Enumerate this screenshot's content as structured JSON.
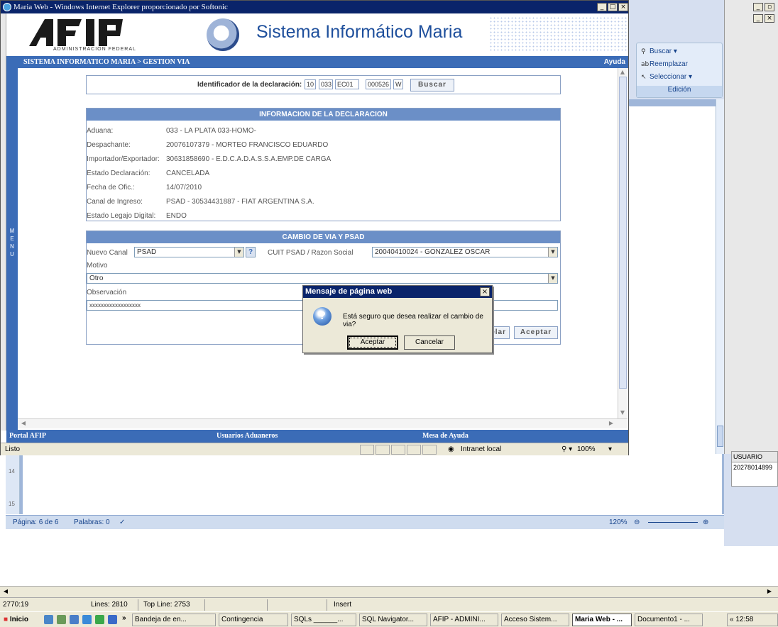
{
  "ie": {
    "title": "Maria Web - Windows Internet Explorer proporcionado por Softonic",
    "system_title": "Sistema Informático Maria",
    "logo_subtitle": "ADMINISTRACION FEDERAL",
    "breadcrumb": "SISTEMA INFORMATICO MARIA > GESTION VIA",
    "help": "Ayuda",
    "menu_letters": [
      "M",
      "E",
      "N",
      "U"
    ],
    "footer": {
      "portal": "Portal AFIP",
      "usuarios": "Usuarios Aduaneros",
      "mesa": "Mesa de Ayuda"
    },
    "status": {
      "ready": "Listo",
      "zone": "Intranet local",
      "zoom": "100%"
    }
  },
  "search": {
    "label": "Identificador de la declaración:",
    "fields": [
      "10",
      "033",
      "EC01",
      "000526",
      "W"
    ],
    "button": "Buscar"
  },
  "info": {
    "heading": "INFORMACION DE LA DECLARACION",
    "rows": [
      {
        "label": "Aduana:",
        "value": "033 - LA PLATA 033-HOMO-"
      },
      {
        "label": "Despachante:",
        "value": "20076107379 - MORTEO FRANCISCO EDUARDO"
      },
      {
        "label": "Importador/Exportador:",
        "value": "30631858690 - E.D.C.A.D.A.S.S.A.EMP.DE CARGA"
      },
      {
        "label": "Estado Declaración:",
        "value": "CANCELADA"
      },
      {
        "label": "Fecha de Ofic.:",
        "value": "14/07/2010"
      },
      {
        "label": "Canal de Ingreso:",
        "value": "PSAD - 30534431887 - FIAT ARGENTINA S.A."
      },
      {
        "label": "Estado Legajo Digital:",
        "value": "ENDO"
      }
    ]
  },
  "cambio": {
    "heading": "CAMBIO DE VIA Y PSAD",
    "nuevo_canal_label": "Nuevo Canal",
    "nuevo_canal_value": "PSAD",
    "help_q": "?",
    "cuit_label": "CUIT PSAD / Razon Social",
    "cuit_value": "20040410024 - GONZALEZ OSCAR",
    "motivo_label": "Motivo",
    "motivo_value": "Otro",
    "obs_label": "Observación",
    "obs_value": "xxxxxxxxxxxxxxxxxx",
    "cancel_partial": "elar",
    "accept": "Aceptar"
  },
  "dialog": {
    "title": "Mensaje de página web",
    "message": "Está seguro que desea realizar el cambio de via?",
    "accept": "Aceptar",
    "cancel": "Cancelar",
    "close": "×"
  },
  "word": {
    "ribbon": {
      "buscar": "Buscar",
      "reemplazar": "Reemplazar",
      "seleccionar": "Seleccionar",
      "group": "Edición"
    },
    "status": {
      "page": "Página: 6 de 6",
      "words": "Palabras: 0",
      "zoom": "120%"
    },
    "ruler_marks": [
      "14",
      "15"
    ]
  },
  "sql_grid": {
    "header": "USUARIO",
    "cell": "20278014899"
  },
  "editor_status": {
    "position": "2770:19",
    "lines": "Lines: 2810",
    "top_line": "Top Line: 2753",
    "mode": "Insert"
  },
  "taskbar": {
    "start": "Inicio",
    "chevron": "»",
    "tasks": [
      {
        "label": "Bandeja de en...",
        "active": false
      },
      {
        "label": "Contingencia",
        "active": false
      },
      {
        "label": "SQLs ______...",
        "active": false
      },
      {
        "label": "SQL Navigator...",
        "active": false
      },
      {
        "label": "AFIP - ADMINI...",
        "active": false
      },
      {
        "label": "Acceso Sistem...",
        "active": false
      },
      {
        "label": "Maria Web - ...",
        "active": true
      },
      {
        "label": "Documento1 - ...",
        "active": false
      }
    ],
    "clock": "« 12:58"
  }
}
